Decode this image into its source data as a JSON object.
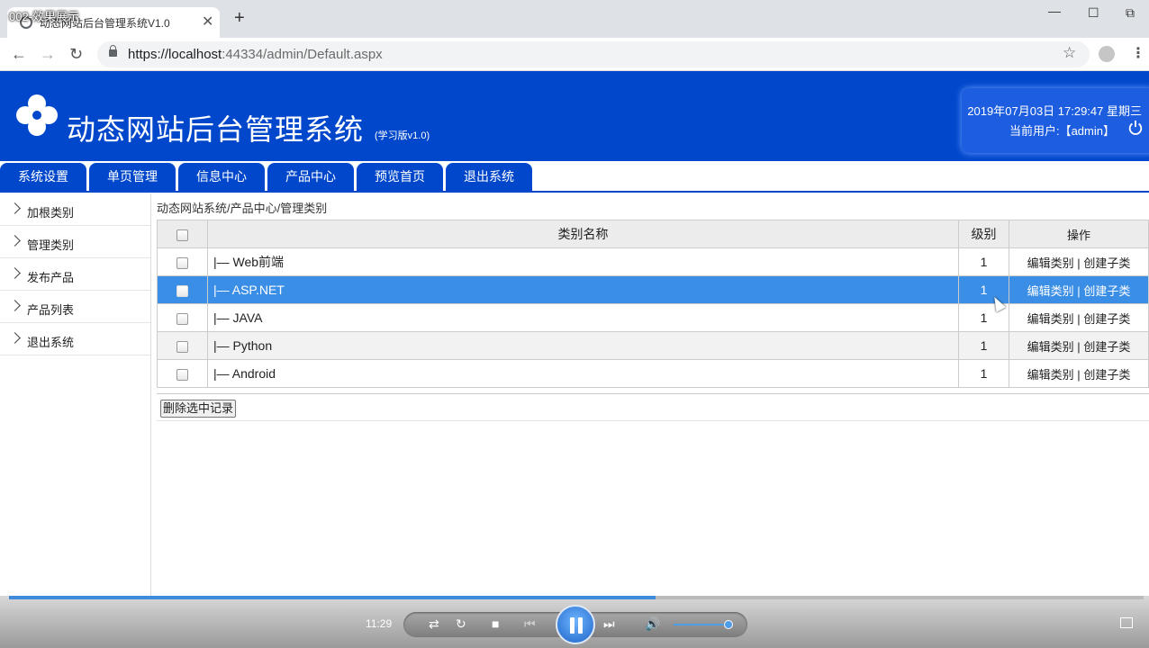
{
  "video_title": "002-效果展示",
  "browser": {
    "tab_title": "动态网站后台管理系统V1.0",
    "url_host": "https://localhost",
    "url_rest": ":44334/admin/Default.aspx"
  },
  "app": {
    "title": "动态网站后台管理系统",
    "version": "(学习版v1.0)",
    "datetime": "2019年07月03日 17:29:47 星期三",
    "current_user": "当前用户:【admin】"
  },
  "nav_tabs": [
    "系统设置",
    "单页管理",
    "信息中心",
    "产品中心",
    "预览首页",
    "退出系统"
  ],
  "sidebar": [
    "加根类别",
    "管理类别",
    "发布产品",
    "产品列表",
    "退出系统"
  ],
  "breadcrumb": "动态网站系统/产品中心/管理类别",
  "table": {
    "headers": {
      "name": "类别名称",
      "level": "级别",
      "ops": "操作"
    },
    "rows": [
      {
        "name": "|— Web前端",
        "level": "1"
      },
      {
        "name": "|— ASP.NET",
        "level": "1"
      },
      {
        "name": "|— JAVA",
        "level": "1"
      },
      {
        "name": "|— Python",
        "level": "1"
      },
      {
        "name": "|— Android",
        "level": "1"
      }
    ],
    "edit_label": "编辑类别",
    "sep": "|",
    "create_label": "创建子类"
  },
  "delete_button": "删除选中记录",
  "player": {
    "time": "11:29",
    "progress": 0.57,
    "volume": 0.9
  }
}
